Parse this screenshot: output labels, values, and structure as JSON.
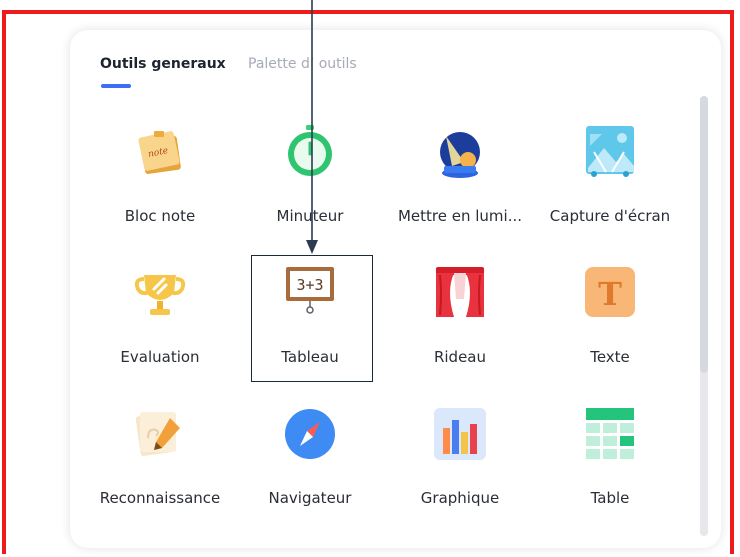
{
  "tabs": [
    {
      "label": "Outils generaux"
    },
    {
      "label": "Palette d’ outils"
    }
  ],
  "tools": [
    {
      "label": "Bloc note",
      "icon": "sticky-note-icon"
    },
    {
      "label": "Minuteur",
      "icon": "timer-icon"
    },
    {
      "label": "Mettre en lumi...",
      "icon": "spotlight-icon"
    },
    {
      "label": "Capture d'écran",
      "icon": "screenshot-icon"
    },
    {
      "label": "Evaluation",
      "icon": "trophy-icon"
    },
    {
      "label": "Tableau",
      "icon": "blackboard-icon",
      "board_text": "3+3",
      "highlighted": true
    },
    {
      "label": "Rideau",
      "icon": "curtain-icon"
    },
    {
      "label": "Texte",
      "icon": "text-icon",
      "glyph": "T"
    },
    {
      "label": "Reconnaissance",
      "icon": "recognition-icon"
    },
    {
      "label": "Navigateur",
      "icon": "compass-icon"
    },
    {
      "label": "Graphique",
      "icon": "bar-chart-icon"
    },
    {
      "label": "Table",
      "icon": "table-icon"
    }
  ],
  "colors": {
    "frame": "#ee1c1c",
    "accent": "#3d6ef5",
    "annotation": "#1d2a3e"
  }
}
